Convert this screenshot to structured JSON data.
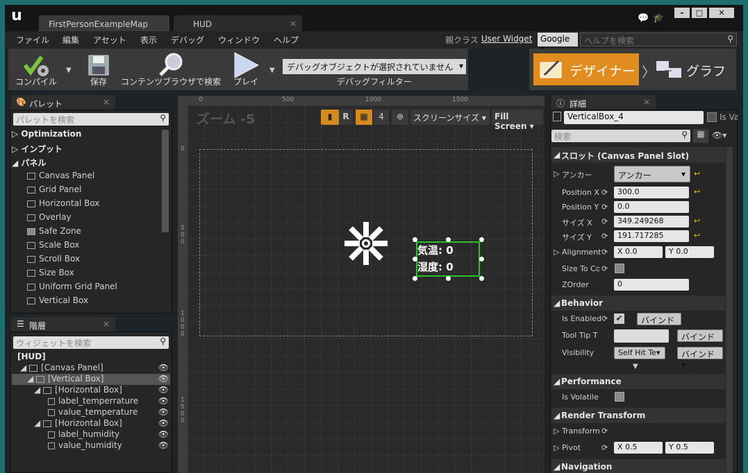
{
  "tabs": [
    {
      "label": "FirstPersonExampleMap"
    },
    {
      "label": "HUD"
    }
  ],
  "menu": [
    "ファイル",
    "編集",
    "アセット",
    "表示",
    "デバッグ",
    "ウィンドウ",
    "ヘルプ"
  ],
  "parent_class": {
    "label": "親クラス",
    "value": "User Widget"
  },
  "search_engine": "Google",
  "help_search_placeholder": "ヘルプを検索",
  "toolbar": {
    "compile": "コンパイル",
    "save": "保存",
    "browse": "コンテンツブラウザで検索",
    "play": "プレイ",
    "debug_object": "デバッグオブジェクトが選択されていません",
    "debug_filter": "デバッグフィルター"
  },
  "modes": {
    "designer": "デザイナー",
    "graph": "グラフ"
  },
  "palette": {
    "title": "パレット",
    "search_placeholder": "パレットを検索",
    "categories": [
      {
        "label": "Optimization",
        "open": false
      },
      {
        "label": "インプット",
        "open": false
      },
      {
        "label": "パネル",
        "open": true
      }
    ],
    "items": [
      "Canvas Panel",
      "Grid Panel",
      "Horizontal Box",
      "Overlay",
      "Safe Zone",
      "Scale Box",
      "Scroll Box",
      "Size Box",
      "Uniform Grid Panel",
      "Vertical Box"
    ]
  },
  "hierarchy": {
    "title": "階層",
    "search_placeholder": "ウィジェットを検索",
    "items": [
      {
        "label": "[HUD]",
        "depth": 0
      },
      {
        "label": "[Canvas Panel]",
        "depth": 1
      },
      {
        "label": "[Vertical Box]",
        "depth": 2
      },
      {
        "label": "[Horizontal Box]",
        "depth": 3
      },
      {
        "label": "label_temperrature",
        "depth": 4
      },
      {
        "label": "value_temperature",
        "depth": 4
      },
      {
        "label": "[Horizontal Box]",
        "depth": 3
      },
      {
        "label": "label_humidity",
        "depth": 4
      },
      {
        "label": "value_humidity",
        "depth": 4
      }
    ]
  },
  "designer": {
    "zoom": "ズーム -5",
    "ruler_h": [
      "0",
      "500",
      "1000",
      "1500"
    ],
    "ruler_v": [
      "0",
      "500",
      "1000",
      "1500"
    ],
    "r_button": "R",
    "grid_num": "4",
    "screen_size": "スクリーンサイズ",
    "fill_screen": "Fill Screen",
    "label_temp": "気温: 0",
    "label_hum": "湿度: 0"
  },
  "details": {
    "title": "詳細",
    "name": "VerticalBox_4",
    "is_variable": "Is Va",
    "search_placeholder": "検索",
    "slot_section": "スロット (Canvas Panel Slot)",
    "anchor_label": "アンカー",
    "anchor_value": "アンカー",
    "pos_x_label": "Position X",
    "pos_x": "300.0",
    "pos_y_label": "Position Y",
    "pos_y": "0.0",
    "size_x_label": "サイズ X",
    "size_x": "349.249268",
    "size_y_label": "サイズ Y",
    "size_y": "191.717285",
    "alignment_label": "Alignment",
    "align_x": "X  0.0",
    "align_y": "Y  0.0",
    "size_to_content_label": "Size To Co",
    "zorder_label": "ZOrder",
    "zorder": "0",
    "behavior_section": "Behavior",
    "is_enabled_label": "Is Enabled",
    "bind": "バインド",
    "tooltip_label": "Tool Tip T",
    "visibility_label": "Visibility",
    "visibility": "Self Hit Te",
    "performance_section": "Performance",
    "is_volatile_label": "Is Volatile",
    "render_section": "Render Transform",
    "transform_label": "Transform",
    "pivot_label": "Pivot",
    "pivot_x": "X  0.5",
    "pivot_y": "Y  0.5",
    "navigation_section": "Navigation"
  }
}
